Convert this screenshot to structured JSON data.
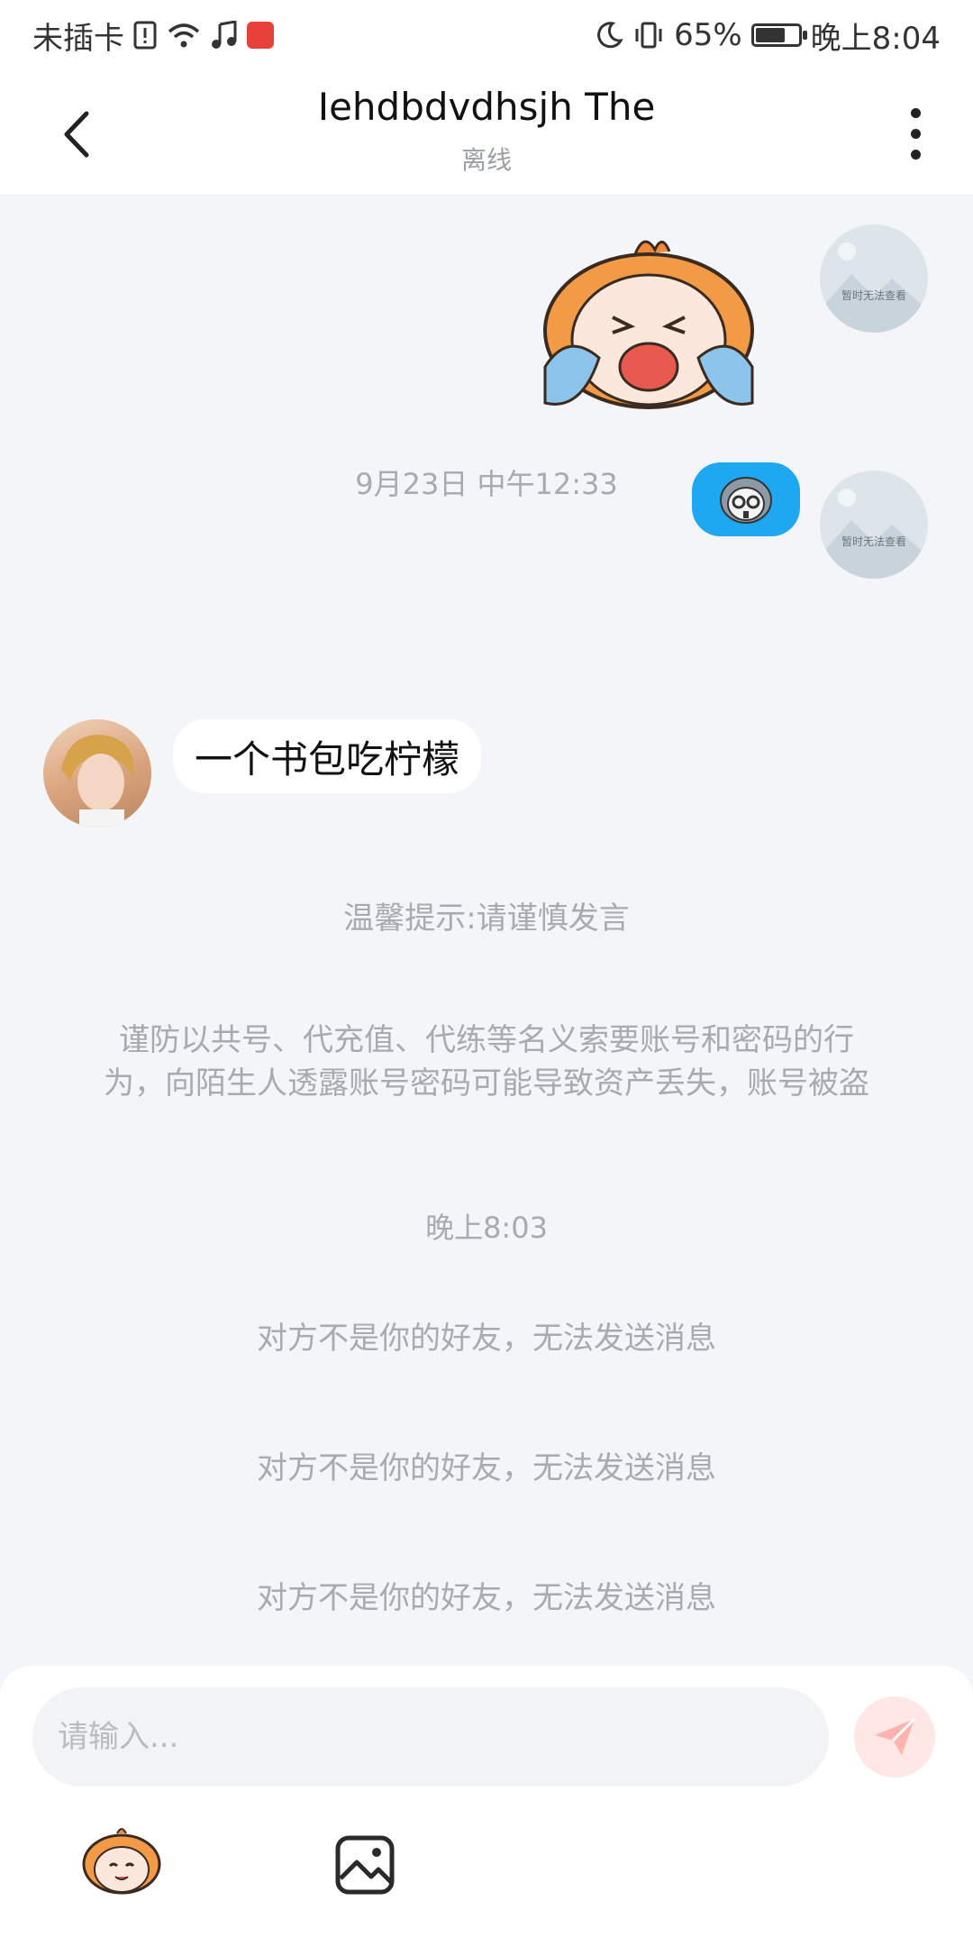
{
  "status_bar": {
    "carrier": "未插卡",
    "battery_percent": "65%",
    "time": "晚上8:04",
    "icons": [
      "sim-alert-icon",
      "wifi-icon",
      "music-icon",
      "huawei-app-icon",
      "moon-icon",
      "vibrate-icon",
      "battery-icon"
    ]
  },
  "header": {
    "title": "Iehdbdvdhsjh The",
    "subtitle": "离线"
  },
  "messages": {
    "avatar_placeholder_caption": "暂时无法查看",
    "timestamp1": "9月23日 中午12:33",
    "text_message": "一个书包吃柠檬",
    "tip": "温馨提示:请谨慎发言",
    "warning_line1": "谨防以共号、代充值、代练等名义索要账号和密码的行",
    "warning_line2": "为，向陌生人透露账号密码可能导致资产丢失，账号被盗",
    "timestamp2": "晚上8:03",
    "system_notices": [
      "对方不是你的好友，无法发送消息",
      "对方不是你的好友，无法发送消息",
      "对方不是你的好友，无法发送消息"
    ]
  },
  "composer": {
    "placeholder": "请输入...",
    "send_icon": "send-icon",
    "emoji_icon": "emoji-sticker-icon",
    "image_icon": "image-icon"
  },
  "colors": {
    "chat_bg": "#f3f5f8",
    "bubble_blue": "#1fa8f2",
    "send_btn_bg": "#ffe7e6",
    "send_icon": "#ff8a84",
    "hint_text": "#a6abb1"
  }
}
